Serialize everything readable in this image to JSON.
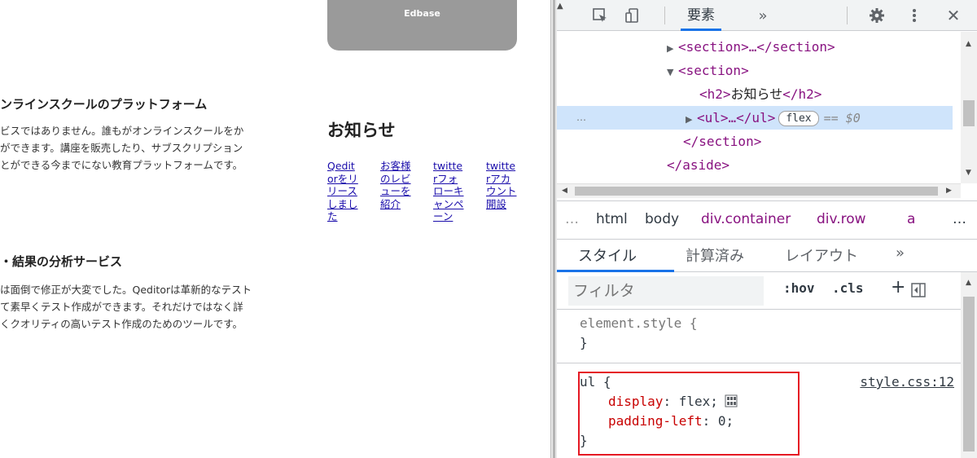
{
  "page": {
    "banner_text": "Edbase",
    "feature1_title": "ンラインスクールのプラットフォーム",
    "feature1_lines": [
      "ビスではありません。誰もがオンラインスクールをか",
      "ができます。講座を販売したり、サブスクリプション",
      "とができる今までにない教育プラットフォームです。"
    ],
    "feature2_title": "・結果の分析サービス",
    "feature2_lines": [
      "は面倒で修正が大変でした。Qeditorは革新的なテスト",
      "て素早くテスト作成ができます。それだけではなく詳",
      "くクオリティの高いテスト作成のためのツールです。"
    ],
    "news_heading": "お知らせ",
    "news_items": [
      "Qeditorをリリースしました",
      "お客様のレビューを紹介",
      "twitterフォローキャンペーン",
      "twitterアカウント開設"
    ]
  },
  "devtools": {
    "tabs": {
      "elements": "要素",
      "more": "»"
    },
    "dom": {
      "line1": "<section>…</section>",
      "line2": "<section>",
      "line3_open": "<h2>",
      "line3_text": "お知らせ",
      "line3_close": "</h2>",
      "line4": "<ul>…</ul>",
      "line4_badge": "flex",
      "line4_eq": "== $0",
      "line4_dots": "…",
      "line5": "</section>",
      "line6": "</aside>"
    },
    "breadcrumbs": {
      "ellipsis": "…",
      "items": [
        "html",
        "body",
        "div.container",
        "div.row",
        "a"
      ],
      "more": "…"
    },
    "style_tabs": [
      "スタイル",
      "計算済み",
      "レイアウト",
      "»"
    ],
    "filter": {
      "placeholder": "フィルタ",
      "hov": ":hov",
      "cls": ".cls",
      "plus": "+"
    },
    "rules": {
      "element_style": "element.style {",
      "close": "}",
      "ul_selector": "ul {",
      "source": "style.css:12",
      "decl1_prop": "display",
      "decl1_val": "flex;",
      "decl2_prop": "padding-left",
      "decl2_val": "0;"
    }
  }
}
